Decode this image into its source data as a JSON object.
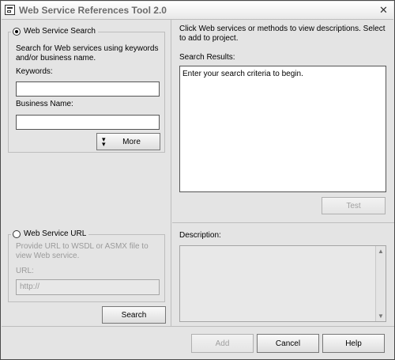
{
  "window": {
    "title": "Web Service References Tool 2.0"
  },
  "left": {
    "search_group": {
      "radio_label": "Web Service Search",
      "description": "Search for Web services using keywords and/or business name.",
      "keywords_label": "Keywords:",
      "keywords_value": "",
      "business_label": "Business Name:",
      "business_value": "",
      "more_label": "More"
    },
    "url_group": {
      "radio_label": "Web Service URL",
      "description": "Provide URL to WSDL or ASMX file to view Web service.",
      "url_label": "URL:",
      "url_placeholder": "http://"
    },
    "search_button": "Search"
  },
  "right": {
    "instructions": "Click Web services or methods to view descriptions. Select to add to project.",
    "results_label": "Search Results:",
    "results_text": "Enter your search criteria to begin.",
    "test_button": "Test",
    "description_label": "Description:"
  },
  "footer": {
    "add": "Add",
    "cancel": "Cancel",
    "help": "Help"
  }
}
